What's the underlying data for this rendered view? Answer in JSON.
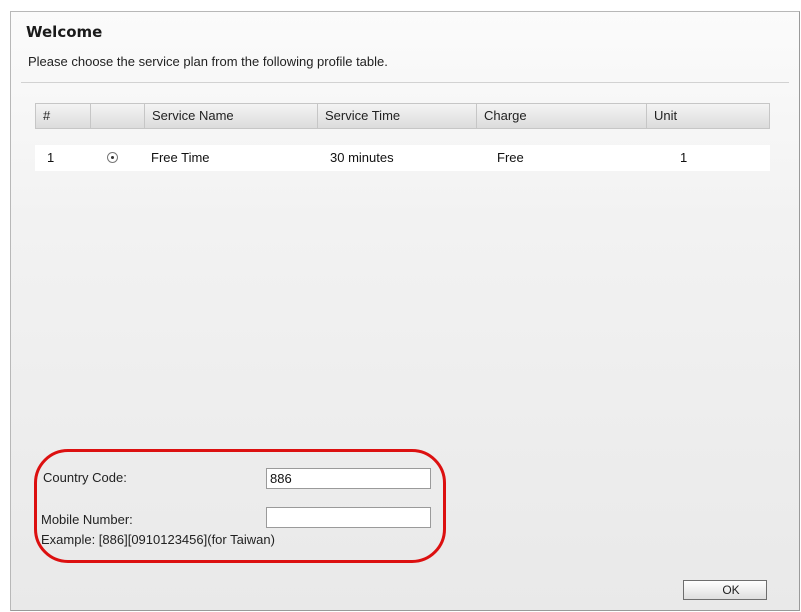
{
  "header": {
    "title": "Welcome",
    "subtitle": "Please choose the service plan from the following profile table."
  },
  "table": {
    "columns": [
      "#",
      "",
      "Service Name",
      "Service Time",
      "Charge",
      "Unit"
    ],
    "rows": [
      {
        "index": "1",
        "selected": true,
        "service_name": "Free Time",
        "service_time": "30 minutes",
        "charge": "Free",
        "unit": "1"
      }
    ]
  },
  "form": {
    "country_code": {
      "label": "Country Code:",
      "value": "886"
    },
    "mobile_number": {
      "label": "Mobile Number:",
      "value": ""
    },
    "example": "Example: [886][0910123456](for Taiwan)"
  },
  "actions": {
    "ok_label": "OK"
  },
  "colors": {
    "highlight": "#dc1010",
    "header_bg": "#dcdcdc"
  }
}
